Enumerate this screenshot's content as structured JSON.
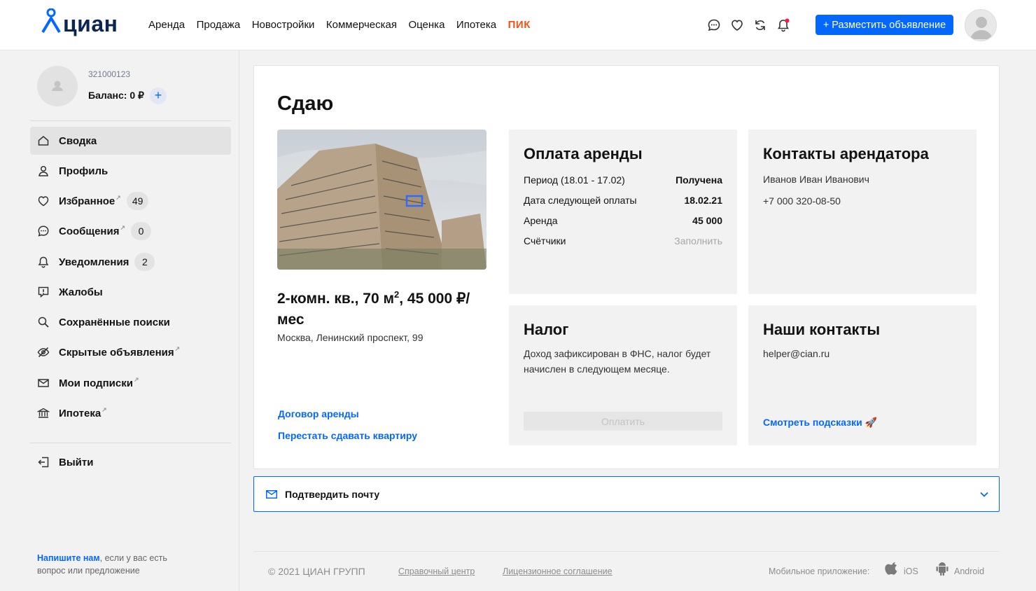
{
  "header": {
    "logo": "циан",
    "nav": [
      "Аренда",
      "Продажа",
      "Новостройки",
      "Коммерческая",
      "Оценка",
      "Ипотека",
      "ПИК"
    ],
    "post_button": "+ Разместить объявление",
    "icons": [
      "chat-icon",
      "heart-icon",
      "compare-icon",
      "bell-icon"
    ],
    "accent_color": "#0468ff"
  },
  "sidebar": {
    "user_id": "321000123",
    "balance": "Баланс: 0 ₽",
    "items": [
      {
        "label": "Сводка",
        "icon": "home-icon"
      },
      {
        "label": "Профиль",
        "icon": "user-icon"
      },
      {
        "label": "Избранное",
        "icon": "heart-icon",
        "badge": "49"
      },
      {
        "label": "Сообщения",
        "icon": "chat-icon",
        "badge": "0"
      },
      {
        "label": "Уведомления",
        "icon": "bell-icon",
        "badge": "2"
      },
      {
        "label": "Жалобы",
        "icon": "complaint-icon"
      },
      {
        "label": "Сохранённые поиски",
        "icon": "saved-search-icon"
      },
      {
        "label": "Скрытые объявления",
        "icon": "eye-off-icon"
      },
      {
        "label": "Мои подписки",
        "icon": "mail-icon"
      },
      {
        "label": "Ипотека",
        "icon": "bank-icon"
      }
    ],
    "logout": "Выйти",
    "footer_link": "Напишите нам",
    "footer_text": ", если у вас есть вопрос или предложение"
  },
  "main": {
    "title": "Сдаю",
    "listing_title_part1": "2-комн. кв., 70 м",
    "listing_title_sup": "2",
    "listing_title_part2": ", 45 000 ₽/мес",
    "address": "Москва, Ленинский проспект, 99",
    "link_contract": "Договор аренды",
    "link_stop": "Перестать сдавать квартиру",
    "rent": {
      "title": "Оплата аренды",
      "rows": [
        {
          "label": "Период (18.01 - 17.02)",
          "value": "Получена"
        },
        {
          "label": "Дата следующей оплаты",
          "value": "18.02.21"
        },
        {
          "label": "Аренда",
          "value": "45 000"
        },
        {
          "label": "Счётчики",
          "value": "Заполнить"
        }
      ]
    },
    "tenant": {
      "title": "Контакты арендатора",
      "name": "Иванов Иван Иванович",
      "phone": "+7 000 320-08-50"
    },
    "tax": {
      "title": "Налог",
      "text": "Доход зафиксирован в ФНС, налог будет начислен в следующем месяце.",
      "button": "Оплатить"
    },
    "our_contacts": {
      "title": "Наши контакты",
      "email": "helper@cian.ru",
      "tips_link": "Смотреть подсказки 🚀"
    }
  },
  "confirm_email": "Подтвердить почту",
  "footer": {
    "copyright": "© 2021 ЦИАН ГРУПП",
    "help": "Справочный центр",
    "license": "Лицензионное соглашение",
    "mobile": "Мобильное приложение:",
    "ios": "iOS",
    "android": "Android"
  }
}
